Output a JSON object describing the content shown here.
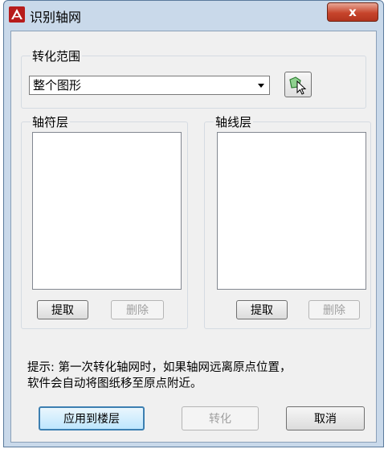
{
  "window": {
    "title": "识别轴网",
    "close_glyph": "x"
  },
  "range_group": {
    "label": "转化范围",
    "dropdown_value": "整个图形"
  },
  "axis_symbol_layer": {
    "label": "轴符层",
    "extract_label": "提取",
    "delete_label": "删除"
  },
  "axis_line_layer": {
    "label": "轴线层",
    "extract_label": "提取",
    "delete_label": "删除"
  },
  "hint": {
    "line1": "提示: 第一次转化轴网时，如果轴网远离原点位置，",
    "line2": "软件会自动将图纸移至原点附近。"
  },
  "footer": {
    "apply_label": "应用到楼层",
    "convert_label": "转化",
    "cancel_label": "取消"
  },
  "colors": {
    "accent": "#3c7fb1",
    "app_icon": "#c62828",
    "close_button": "#c7452c"
  },
  "icons": {
    "app": "autocad-logo-icon",
    "pick": "pick-objects-icon"
  }
}
